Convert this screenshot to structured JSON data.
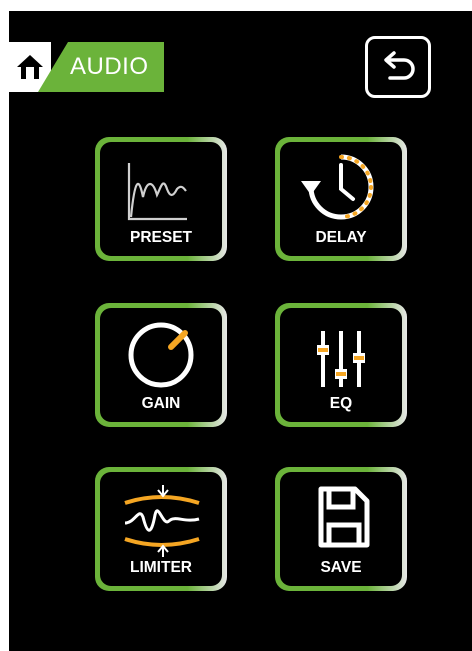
{
  "header": {
    "home_icon": "home-icon",
    "title": "AUDIO",
    "back_icon": "back-icon"
  },
  "tiles": [
    {
      "label": "PRESET",
      "icon": "frequency-curve-icon"
    },
    {
      "label": "DELAY",
      "icon": "clock-arrow-icon"
    },
    {
      "label": "GAIN",
      "icon": "knob-icon"
    },
    {
      "label": "EQ",
      "icon": "sliders-icon"
    },
    {
      "label": "LIMITER",
      "icon": "limiter-wave-icon"
    },
    {
      "label": "SAVE",
      "icon": "floppy-disk-icon"
    }
  ],
  "colors": {
    "accent_green": "#6bb33a",
    "accent_orange": "#f5a623",
    "background": "#000000",
    "foreground": "#ffffff"
  }
}
